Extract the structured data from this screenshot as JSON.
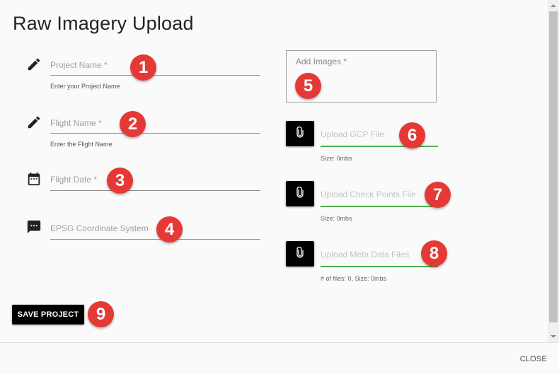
{
  "dialog": {
    "title": "Raw Imagery Upload"
  },
  "fields": [
    {
      "icon": "pencil-icon",
      "label": "Project Name *",
      "hint": "Enter your Project Name",
      "value": ""
    },
    {
      "icon": "pencil-icon",
      "label": "Flight Name *",
      "hint": "Enter the Flight Name",
      "value": ""
    },
    {
      "icon": "calendar-icon",
      "label": "Flight Date *",
      "hint": "",
      "value": ""
    },
    {
      "icon": "comment-icon",
      "label": "EPSG Coordinate System",
      "hint": "",
      "value": ""
    }
  ],
  "add_images": {
    "label": "Add Images *"
  },
  "uploads": [
    {
      "icon": "paperclip-icon",
      "label": "Upload GCP File",
      "info": "Size: 0mbs"
    },
    {
      "icon": "paperclip-icon",
      "label": "Upload Check Points File",
      "info": "Size: 0mbs"
    },
    {
      "icon": "paperclip-icon",
      "label": "Upload Meta Data Files",
      "info": "# of files: 0, Size: 0mbs"
    }
  ],
  "actions": {
    "save_label": "SAVE PROJECT",
    "close_label": "CLOSE"
  },
  "annotations": [
    "1",
    "2",
    "3",
    "4",
    "5",
    "6",
    "7",
    "8",
    "9"
  ],
  "colors": {
    "badge": "#e53935",
    "upload_underline": "#4caf50",
    "button": "#000000"
  }
}
